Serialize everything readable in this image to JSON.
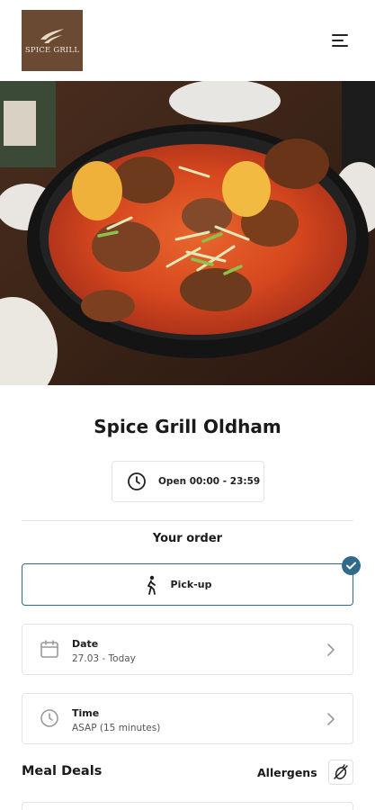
{
  "header": {
    "logo_text": "SPICE GRILL",
    "logo_color": "#6b4a33",
    "menu_icon": "hamburger-menu-icon"
  },
  "hero": {
    "image_subject": "pot of spicy stew with potatoes, meat and spring onions"
  },
  "restaurant": {
    "name": "Spice Grill Oldham",
    "hours": "Open 00:00 - 23:59"
  },
  "order": {
    "heading": "Your order",
    "mode_label": "Pick-up",
    "mode_selected": true,
    "accent_color": "#2f6a8a"
  },
  "date": {
    "label": "Date",
    "value": "27.03 - Today"
  },
  "time": {
    "label": "Time",
    "value": "ASAP (15 minutes)"
  },
  "menu": {
    "section_title": "Meal Deals",
    "allergens_label": "Allergens"
  }
}
